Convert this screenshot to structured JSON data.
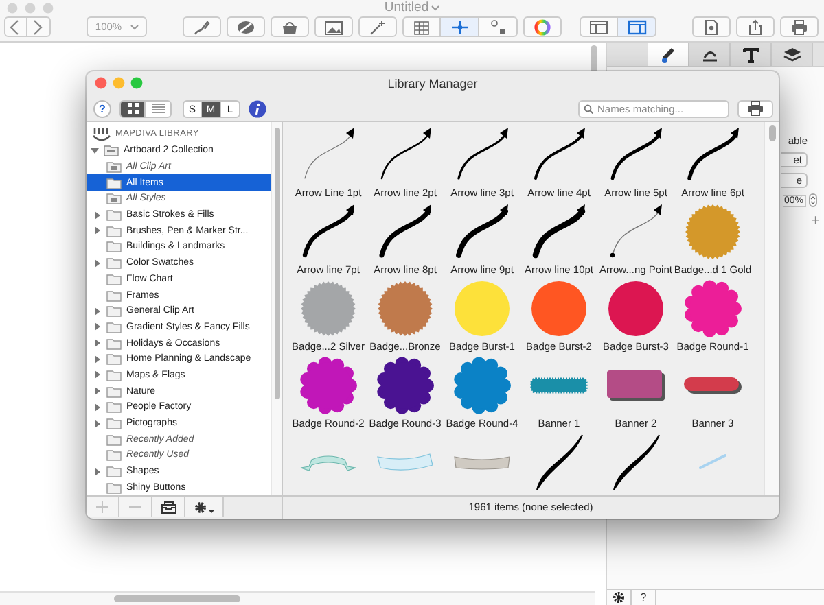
{
  "window": {
    "title": "Untitled"
  },
  "toolbar": [
    {
      "kind": "segment",
      "buttons": [
        {
          "on": false
        },
        {
          "on": false
        }
      ]
    },
    {
      "kind": "zoom",
      "label": "100%"
    },
    {
      "kind": "segment",
      "buttons": [
        {
          "on": false
        }
      ]
    },
    {
      "kind": "segment",
      "buttons": [
        {
          "on": false
        }
      ]
    },
    {
      "kind": "segment",
      "buttons": [
        {
          "on": false
        }
      ]
    },
    {
      "kind": "segment",
      "buttons": [
        {
          "on": false
        }
      ]
    },
    {
      "kind": "segment",
      "buttons": [
        {
          "on": false
        }
      ]
    },
    {
      "kind": "segment",
      "buttons": [
        {
          "on": false
        },
        {
          "on": true
        },
        {
          "on": false
        }
      ]
    },
    {
      "kind": "segment",
      "buttons": [
        {
          "on": false
        }
      ]
    },
    {
      "kind": "spacer"
    },
    {
      "kind": "segment",
      "buttons": [
        {
          "on": false
        },
        {
          "on": true
        }
      ]
    },
    {
      "kind": "segment",
      "buttons": [
        {
          "on": false
        }
      ]
    },
    {
      "kind": "segment",
      "buttons": [
        {
          "on": false
        }
      ]
    },
    {
      "kind": "segment",
      "buttons": [
        {
          "on": false
        }
      ]
    }
  ],
  "inspector": {
    "tabs": [
      {
        "selected": true
      },
      {
        "selected": false
      },
      {
        "selected": false
      },
      {
        "selected": false
      }
    ],
    "fields": [
      {
        "kind": "label",
        "text": "able"
      },
      {
        "kind": "popup",
        "text": "et"
      },
      {
        "kind": "popup",
        "text": "e"
      },
      {
        "kind": "stepper",
        "text": "00%"
      },
      {
        "kind": "add",
        "text": "+"
      }
    ],
    "footer": [
      {
        "kind": "gear"
      },
      {
        "kind": "text",
        "text": "?"
      }
    ]
  },
  "dialog": {
    "title": "Library Manager",
    "help": "?",
    "view_modes": [
      {
        "kind": "grid",
        "selected": true
      },
      {
        "kind": "list",
        "selected": false
      }
    ],
    "sizes": [
      {
        "label": "S",
        "selected": false
      },
      {
        "label": "M",
        "selected": true
      },
      {
        "label": "L",
        "selected": false
      }
    ],
    "search": {
      "placeholder": "Names matching..."
    },
    "sidebar": {
      "header": "MAPDIVA LIBRARY",
      "items": [
        {
          "label": "Artboard 2 Collection",
          "kind": "collection",
          "expanded": true,
          "children": [
            {
              "label": "All Clip Art",
              "kind": "smart",
              "selected": false
            },
            {
              "label": "All Items",
              "kind": "folder",
              "selected": true
            },
            {
              "label": "All Styles",
              "kind": "smart",
              "selected": false
            },
            {
              "label": "Basic Strokes & Fills",
              "kind": "group",
              "selected": false
            },
            {
              "label": "Brushes, Pen & Marker Str...",
              "kind": "group",
              "selected": false
            },
            {
              "label": "Buildings & Landmarks",
              "kind": "folder",
              "selected": false
            },
            {
              "label": "Color Swatches",
              "kind": "group",
              "selected": false
            },
            {
              "label": "Flow Chart",
              "kind": "folder",
              "selected": false
            },
            {
              "label": "Frames",
              "kind": "folder",
              "selected": false
            },
            {
              "label": "General Clip Art",
              "kind": "group",
              "selected": false
            },
            {
              "label": "Gradient Styles & Fancy Fills",
              "kind": "group",
              "selected": false
            },
            {
              "label": "Holidays & Occasions",
              "kind": "group",
              "selected": false
            },
            {
              "label": "Home Planning & Landscape",
              "kind": "group",
              "selected": false
            },
            {
              "label": "Maps & Flags",
              "kind": "group",
              "selected": false
            },
            {
              "label": "Nature",
              "kind": "group",
              "selected": false
            },
            {
              "label": "People Factory",
              "kind": "group",
              "selected": false
            },
            {
              "label": "Pictographs",
              "kind": "group",
              "selected": false
            },
            {
              "label": "Recently Added",
              "kind": "recent",
              "selected": false
            },
            {
              "label": "Recently Used",
              "kind": "recent",
              "selected": false
            },
            {
              "label": "Shapes",
              "kind": "group",
              "selected": false
            },
            {
              "label": "Shiny Buttons",
              "kind": "folder",
              "selected": false
            }
          ]
        }
      ]
    },
    "items": [
      {
        "label": "Arrow Line 1pt",
        "kind": "arrow"
      },
      {
        "label": "Arrow line 2pt",
        "kind": "arrow"
      },
      {
        "label": "Arrow line 3pt",
        "kind": "arrow"
      },
      {
        "label": "Arrow line 4pt",
        "kind": "arrow"
      },
      {
        "label": "Arrow line 5pt",
        "kind": "arrow"
      },
      {
        "label": "Arrow line 6pt",
        "kind": "arrow"
      },
      {
        "label": "Arrow line 7pt",
        "kind": "arrow"
      },
      {
        "label": "Arrow line 8pt",
        "kind": "arrow"
      },
      {
        "label": "Arrow line 9pt",
        "kind": "arrow"
      },
      {
        "label": "Arrow line 10pt",
        "kind": "arrow"
      },
      {
        "label": "Arrow...ng Point",
        "kind": "pointer"
      },
      {
        "label": "Badge...d 1 Gold",
        "kind": "seal",
        "color": "#d4982a"
      },
      {
        "label": "Badge...2 Silver",
        "kind": "seal",
        "color": "#a4a6a8"
      },
      {
        "label": "Badge...Bronze",
        "kind": "seal",
        "color": "#c07a4c"
      },
      {
        "label": "Badge Burst-1",
        "kind": "disc",
        "color": "#fde13a"
      },
      {
        "label": "Badge Burst-2",
        "kind": "disc",
        "color": "#ff5622"
      },
      {
        "label": "Badge Burst-3",
        "kind": "disc",
        "color": "#dc1651"
      },
      {
        "label": "Badge Round-1",
        "kind": "flower",
        "color": "#ec1e98"
      },
      {
        "label": "Badge Round-2",
        "kind": "flower",
        "color": "#c117b8"
      },
      {
        "label": "Badge Round-3",
        "kind": "flower",
        "color": "#4a1392"
      },
      {
        "label": "Badge Round-4",
        "kind": "flower",
        "color": "#0b82c6"
      },
      {
        "label": "Banner 1",
        "kind": "tag",
        "color": "#1a8fa8"
      },
      {
        "label": "Banner 2",
        "kind": "card",
        "color": "#b44c86"
      },
      {
        "label": "Banner 3",
        "kind": "pill",
        "color": "#d33c4c"
      },
      {
        "kind": "ribbon"
      },
      {
        "kind": "scroll"
      },
      {
        "kind": "plank"
      },
      {
        "kind": "swoosh"
      },
      {
        "kind": "swoosh"
      },
      {
        "kind": "stroke"
      }
    ],
    "footer_buttons": [
      {
        "disabled": true
      },
      {
        "disabled": true
      },
      {
        "disabled": false
      },
      {
        "disabled": false
      }
    ],
    "status": "1961 items (none selected)"
  }
}
